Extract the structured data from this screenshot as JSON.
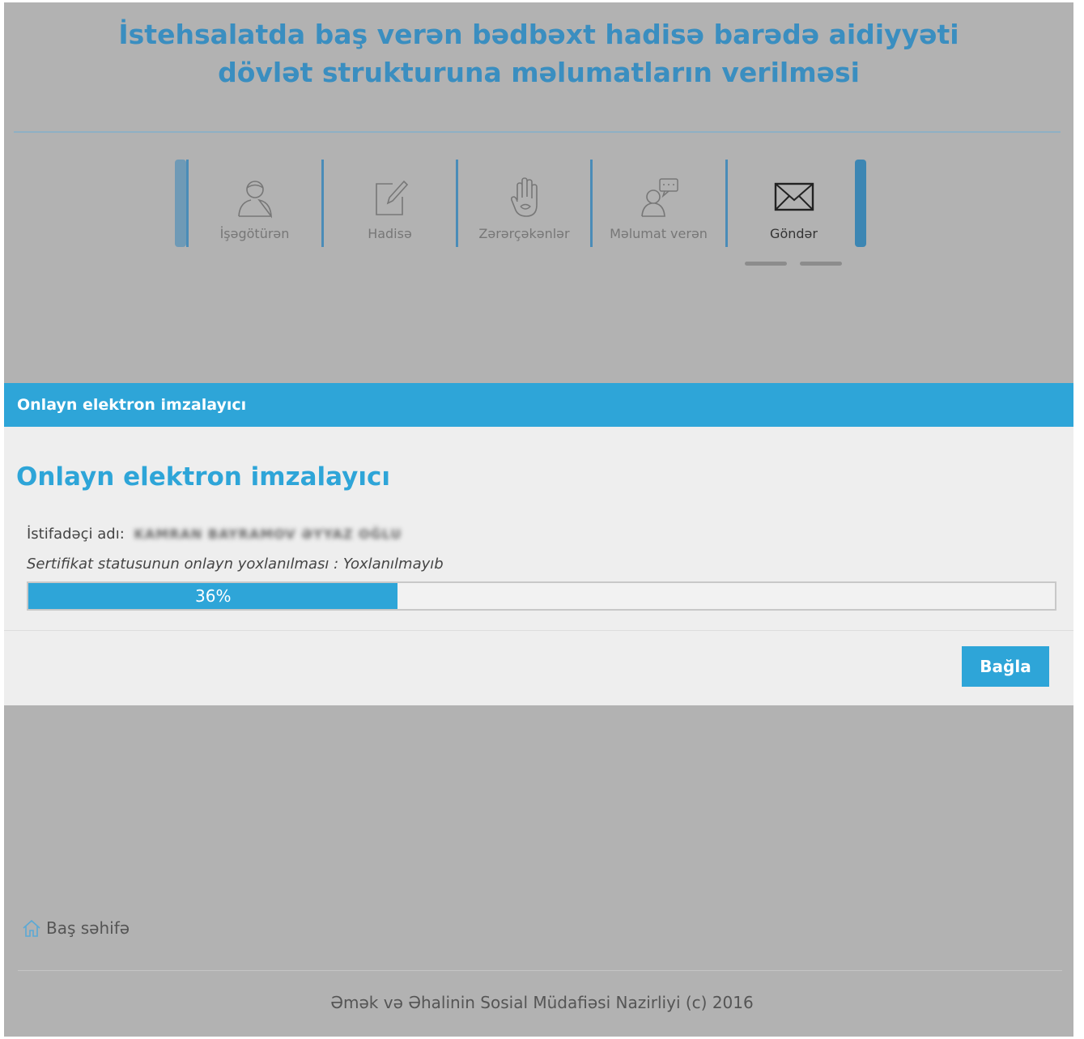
{
  "page": {
    "title_line1": "İstehsalatda baş verən bədbəxt hadisə barədə aidiyyəti",
    "title_line2": "dövlət strukturuna məlumatların verilməsi"
  },
  "steps": [
    {
      "label": "İşəgötürən",
      "icon": "user-icon",
      "active": false
    },
    {
      "label": "Hadisə",
      "icon": "edit-icon",
      "active": false
    },
    {
      "label": "Zərərçəkənlər",
      "icon": "hand-icon",
      "active": false
    },
    {
      "label": "Məlumat verən",
      "icon": "informant-icon",
      "active": false
    },
    {
      "label": "Göndər",
      "icon": "envelope-icon",
      "active": true
    }
  ],
  "modal": {
    "header": "Onlayn elektron imzalayıcı",
    "title": "Onlayn elektron imzalayıcı",
    "user_label": "İstifadəçi adı:",
    "user_value": "KAMRAN BAYRAMOV ƏYYAZ OĞLU",
    "cert_text": "Sertifikat statusunun onlayn yoxlanılması : Yoxlanılmayıb",
    "progress_percent": 36,
    "progress_label": "36%",
    "close_button": "Bağla"
  },
  "footer": {
    "home_link": "Baş səhifə",
    "copyright": "Əmək və Əhalinin Sosial Müdafiəsi Nazirliyi (c) 2016"
  },
  "colors": {
    "accent": "#2ea5d8",
    "title": "#3a8ec0",
    "overlay": "#b2b2b2",
    "modal_bg": "#eeeeee"
  }
}
